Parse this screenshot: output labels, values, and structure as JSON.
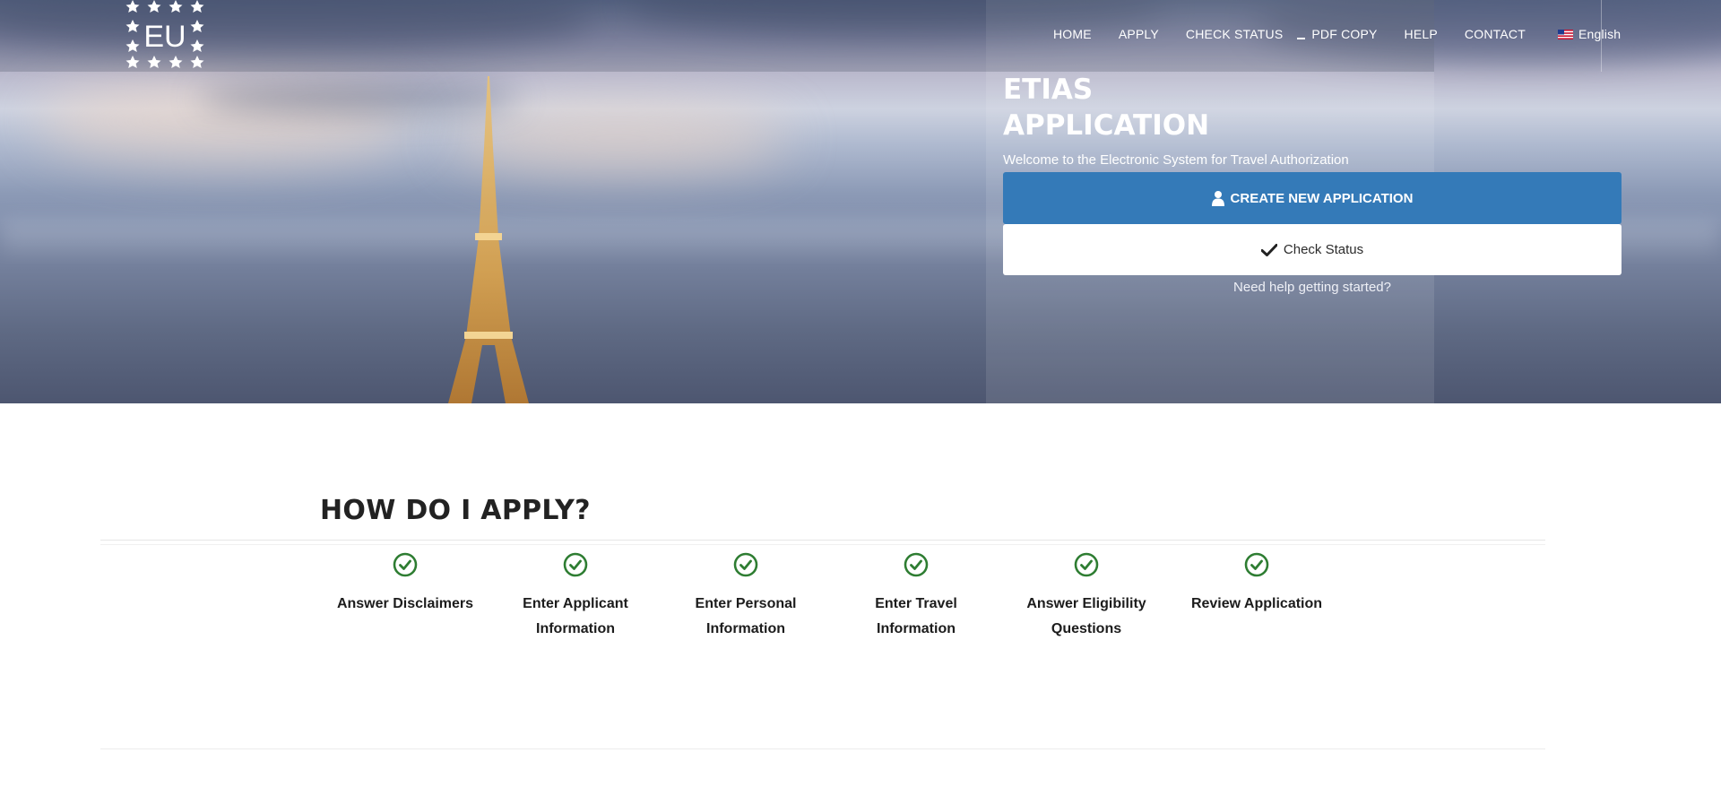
{
  "logo": {
    "text": "EU",
    "icon": "eu-stars-logo"
  },
  "nav": {
    "items": [
      "HOME",
      "APPLY",
      "CHECK STATUS",
      "PDF COPY",
      "HELP",
      "CONTACT"
    ],
    "language": "English",
    "language_icon": "us-flag-icon"
  },
  "hero": {
    "title": "ETIAS APPLICATION",
    "subtitle": "Welcome to the Electronic System for Travel Authorization",
    "create_button": "CREATE NEW APPLICATION",
    "create_icon": "user-icon",
    "status_button": "Check Status",
    "status_icon": "checkmark-icon",
    "help_link": "Need help getting started?"
  },
  "how": {
    "title": "HOW DO I APPLY?",
    "steps": [
      "Answer Disclaimers",
      "Enter Applicant Information",
      "Enter Personal Information",
      "Enter Travel Information",
      "Answer Eligibility Questions",
      "Review Application"
    ],
    "step_icon": "check-circle-icon",
    "accent_color": "#2e7d32"
  },
  "colors": {
    "primary_button": "#347ab8",
    "nav_text": "#ffffff"
  }
}
